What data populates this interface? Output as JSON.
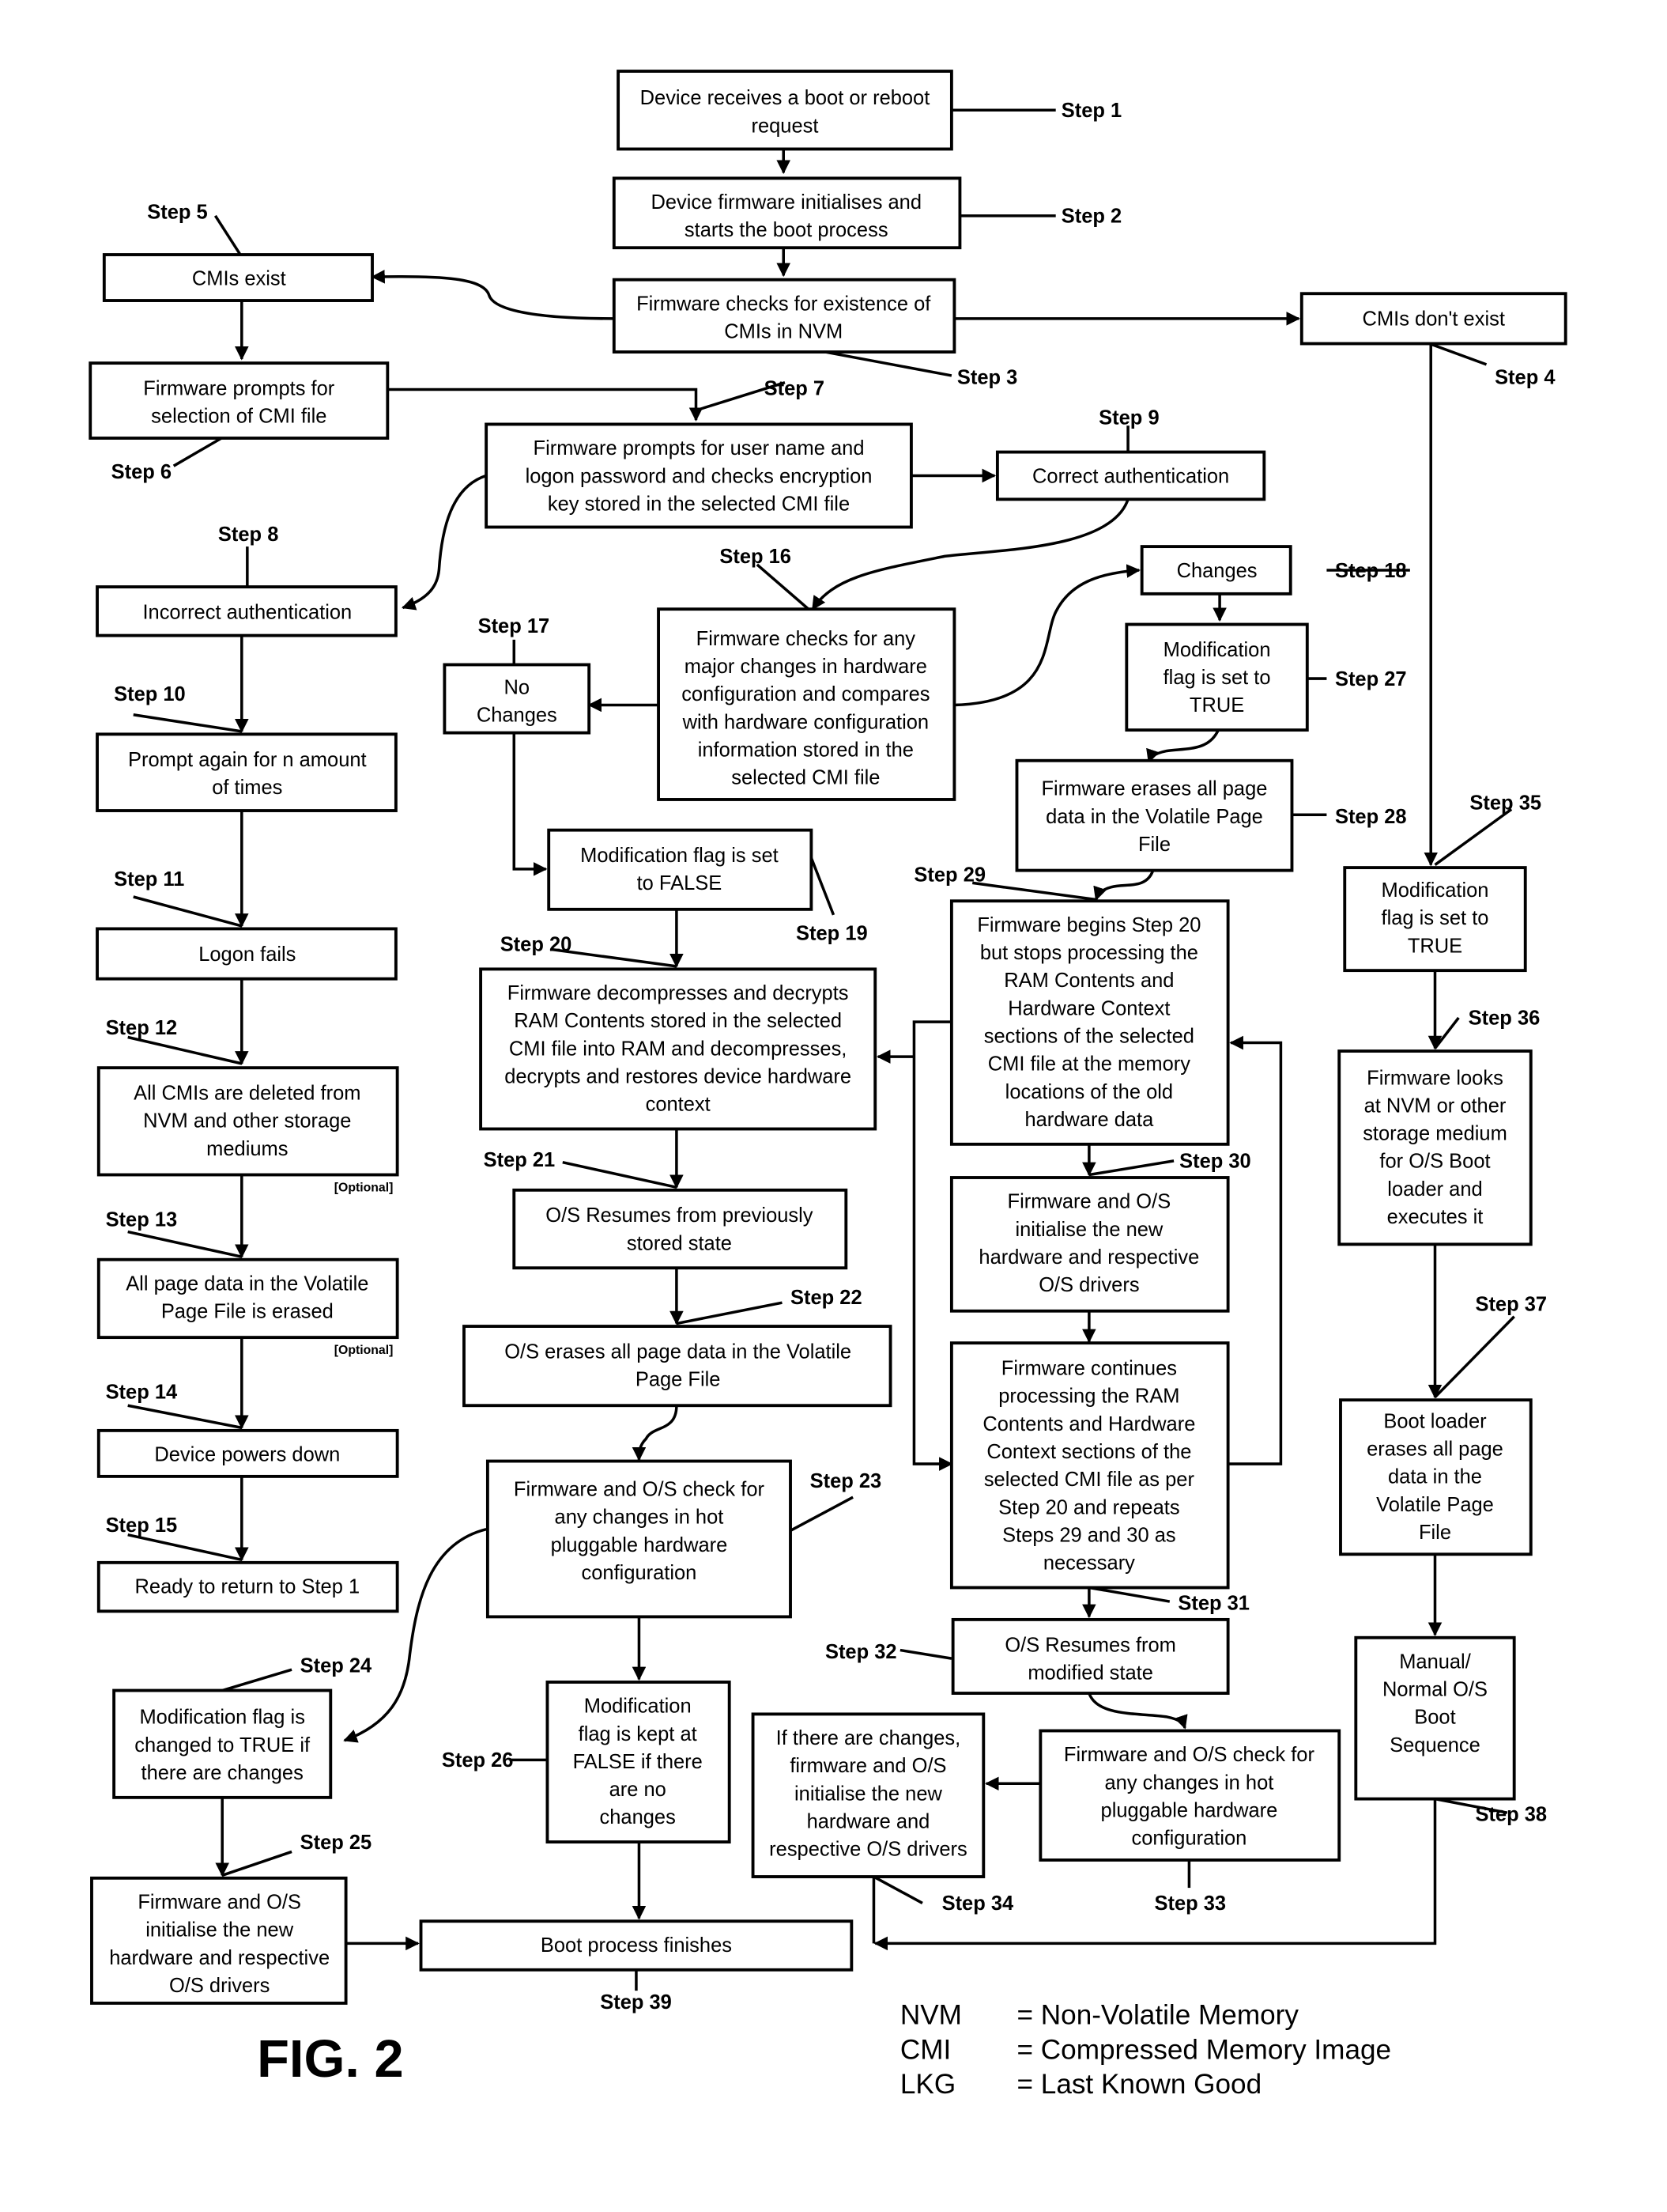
{
  "figure_label": "FIG. 2",
  "boxes": {
    "s1": [
      "Device receives a boot or reboot",
      "request"
    ],
    "s2": [
      "Device firmware initialises and",
      "starts the boot process"
    ],
    "s3": [
      "Firmware checks for existence of",
      "CMIs in NVM"
    ],
    "s5": [
      "CMIs exist"
    ],
    "s4": [
      "CMIs don't exist"
    ],
    "s6": [
      "Firmware prompts for",
      "selection of CMI file"
    ],
    "s7": [
      "Firmware prompts for user name and",
      "logon password and checks encryption",
      "key stored in the selected CMI file"
    ],
    "s9": [
      "Correct authentication"
    ],
    "s8": [
      "Incorrect authentication"
    ],
    "s16": [
      "Firmware checks for any",
      "major changes in hardware",
      "configuration and compares",
      "with hardware configuration",
      "information stored in the",
      "selected CMI file"
    ],
    "s17": [
      "No",
      "Changes"
    ],
    "s18": [
      "Changes"
    ],
    "s27": [
      "Modification",
      "flag is set to",
      "TRUE"
    ],
    "s28": [
      "Firmware erases all page",
      "data in the Volatile Page",
      "File"
    ],
    "s10": [
      "Prompt again for n amount",
      "of times"
    ],
    "s19": [
      "Modification flag is set",
      "to FALSE"
    ],
    "s35": [
      "Modification",
      "flag is set to",
      "TRUE"
    ],
    "s29": [
      "Firmware begins Step 20",
      "but stops processing the",
      "RAM Contents and",
      "Hardware Context",
      "sections of the selected",
      "CMI file at the memory",
      "locations of the old",
      "hardware data"
    ],
    "s11": [
      "Logon fails"
    ],
    "s20": [
      "Firmware decompresses and decrypts",
      "RAM Contents stored in the selected",
      "CMI file into RAM and decompresses,",
      "decrypts and restores device hardware",
      "context"
    ],
    "s36": [
      "Firmware looks",
      "at NVM or other",
      "storage medium",
      "for O/S Boot",
      "loader and",
      "executes it"
    ],
    "s12": [
      "All CMIs are deleted from",
      "NVM and other storage",
      "mediums"
    ],
    "s30": [
      "Firmware and O/S",
      "initialise the new",
      "hardware and respective",
      "O/S drivers"
    ],
    "s21": [
      "O/S Resumes from previously",
      "stored state"
    ],
    "s13": [
      "All page data in the Volatile",
      "Page File is erased"
    ],
    "s22": [
      "O/S erases all page data in the Volatile",
      "Page File"
    ],
    "s31": [
      "Firmware continues",
      "processing the RAM",
      "Contents and Hardware",
      "Context sections of the",
      "selected CMI file as per",
      "Step 20 and repeats",
      "Steps 29 and 30 as",
      "necessary"
    ],
    "s37": [
      "Boot loader",
      "erases all page",
      "data in the",
      "Volatile Page",
      "File"
    ],
    "s14": [
      "Device powers down"
    ],
    "s23": [
      "Firmware and O/S check for",
      "any changes in hot",
      "pluggable hardware",
      "configuration"
    ],
    "s15": [
      "Ready to return to Step 1"
    ],
    "s32": [
      "O/S Resumes from",
      "modified state"
    ],
    "s38": [
      "Manual/",
      "Normal O/S",
      "Boot",
      "Sequence"
    ],
    "s24": [
      "Modification flag is",
      "changed to TRUE if",
      "there are changes"
    ],
    "s26": [
      "Modification",
      "flag is kept at",
      "FALSE if there",
      "are no",
      "changes"
    ],
    "s34": [
      "If there are changes,",
      "firmware and O/S",
      "initialise the new",
      "hardware and",
      "respective O/S drivers"
    ],
    "s33": [
      "Firmware and O/S check for",
      "any changes in hot",
      "pluggable hardware",
      "configuration"
    ],
    "s25": [
      "Firmware and O/S",
      "initialise the new",
      "hardware and respective",
      "O/S drivers"
    ],
    "s39": [
      "Boot process finishes"
    ]
  },
  "step_labels": {
    "l1": "Step 1",
    "l2": "Step 2",
    "l3": "Step 3",
    "l4": "Step 4",
    "l5": "Step 5",
    "l6": "Step 6",
    "l7": "Step 7",
    "l8": "Step 8",
    "l9": "Step 9",
    "l10": "Step 10",
    "l11": "Step 11",
    "l12": "Step 12",
    "l13": "Step 13",
    "l14": "Step 14",
    "l15": "Step 15",
    "l16": "Step 16",
    "l17": "Step 17",
    "l18": "Step 18",
    "l19": "Step 19",
    "l20": "Step 20",
    "l21": "Step 21",
    "l22": "Step 22",
    "l23": "Step 23",
    "l24": "Step 24",
    "l25": "Step 25",
    "l26": "Step 26",
    "l27": "Step 27",
    "l28": "Step 28",
    "l29": "Step 29",
    "l30": "Step 30",
    "l31": "Step 31",
    "l32": "Step 32",
    "l33": "Step 33",
    "l34": "Step 34",
    "l35": "Step 35",
    "l36": "Step 36",
    "l37": "Step 37",
    "l38": "Step 38",
    "l39": "Step 39"
  },
  "optional_label": "[Optional]",
  "legend": [
    {
      "abbr": "NVM",
      "meaning": "= Non-Volatile Memory"
    },
    {
      "abbr": "CMI",
      "meaning": "= Compressed Memory Image"
    },
    {
      "abbr": "LKG",
      "meaning": "= Last Known Good"
    }
  ]
}
